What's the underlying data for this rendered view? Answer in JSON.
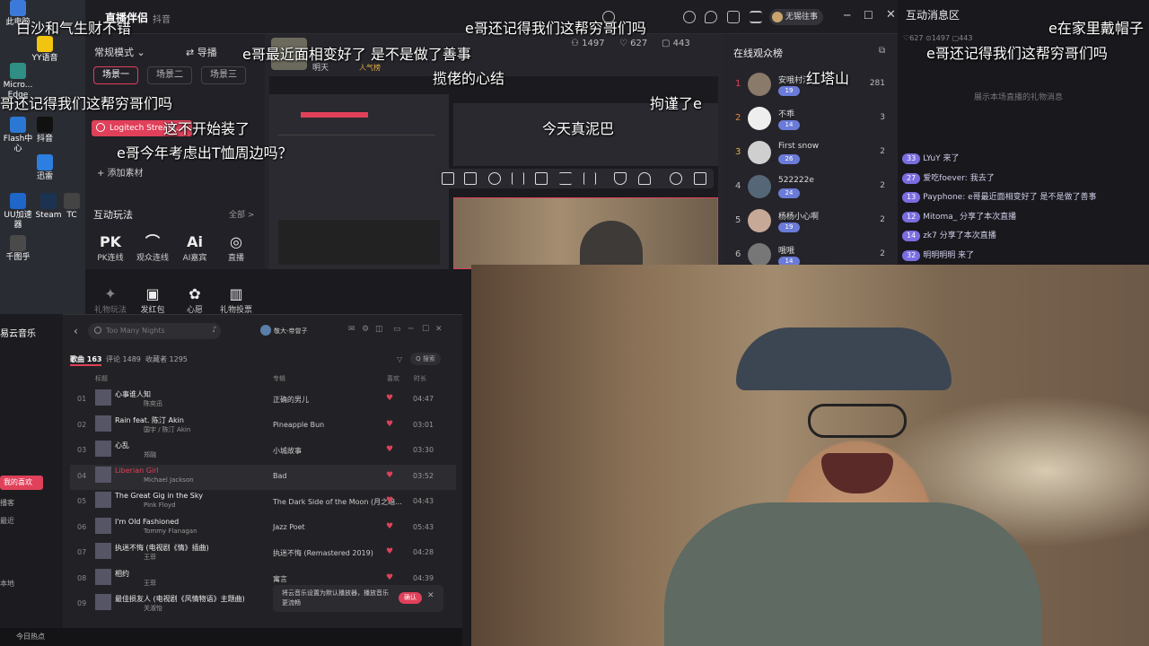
{
  "desktop": {
    "icons": [
      {
        "label": "此电脑",
        "color": "#3b7ad9"
      },
      {
        "label": "Micro...\nEdge",
        "color": "#2f8f84"
      },
      {
        "label": "Flash中\n心",
        "color": "#2a78d4"
      },
      {
        "label": "UU加速\n器",
        "color": "#1f66c9"
      },
      {
        "label": "Steam",
        "color": "#1b3350"
      },
      {
        "label": "千图乎",
        "color": "#4a4a4a"
      },
      {
        "label": "YY语音",
        "color": "#f1c40f"
      },
      {
        "label": "抖音",
        "color": "#111111"
      },
      {
        "label": "迅雷",
        "color": "#2c7ee0"
      },
      {
        "label": "TC",
        "color": "#444444"
      }
    ]
  },
  "console": {
    "title": "直播伴侣",
    "subtitle": "抖音",
    "mode_label": "常规模式",
    "guide_label": "导播",
    "scene_tabs": [
      "场景一",
      "场景二",
      "场景三"
    ],
    "source_item": "Logitech Stream...",
    "add_material": "+ 添加素材",
    "stats": {
      "viewers": "1497",
      "likes": "627",
      "gifts": "443"
    },
    "streamer_name": "明天",
    "streamer_tag": "人气榜",
    "user_label": "无锡往事",
    "interactive_label": "互动玩法",
    "interactive_all": "全部 >",
    "functions": [
      {
        "glyph": "PK",
        "label": "PK连线"
      },
      {
        "glyph": "⌒",
        "label": "观众连线"
      },
      {
        "glyph": "Ai",
        "label": "AI嘉宾"
      },
      {
        "glyph": "◎",
        "label": "直播"
      },
      {
        "glyph": "✦",
        "label": "礼物玩法"
      },
      {
        "glyph": "▣",
        "label": "发红包"
      },
      {
        "glyph": "✿",
        "label": "心愿"
      },
      {
        "glyph": "▥",
        "label": "礼物投票"
      }
    ]
  },
  "audience": {
    "title": "在线观众榜",
    "rows": [
      {
        "rank": "1",
        "name": "安哦村汀",
        "level": "19",
        "score": "281",
        "rank_color": "#e0405a",
        "av_color": "#8a7a6a"
      },
      {
        "rank": "2",
        "name": "不乖",
        "level": "14",
        "score": "3",
        "rank_color": "#e08a40",
        "av_color": "#eeeeee"
      },
      {
        "rank": "3",
        "name": "First snow",
        "level": "26",
        "score": "2",
        "rank_color": "#e0b040",
        "av_color": "#cfcfcf"
      },
      {
        "rank": "4",
        "name": "522222e",
        "level": "24",
        "score": "2",
        "rank_color": "#bbbbbb",
        "av_color": "#556677"
      },
      {
        "rank": "5",
        "name": "杨杨小心啊",
        "level": "19",
        "score": "2",
        "rank_color": "#bbbbbb",
        "av_color": "#c7a998"
      },
      {
        "rank": "6",
        "name": "哦哦",
        "level": "14",
        "score": "2",
        "rank_color": "#bbbbbb",
        "av_color": "#777777"
      }
    ]
  },
  "interact": {
    "title": "互动消息区",
    "stats": "♡627   ⊙1497   ▢443",
    "empty_hint": "展示本场直播的礼物消息",
    "messages": [
      {
        "level": "33",
        "text": "LYuY 来了"
      },
      {
        "level": "27",
        "text": "爱吃foever: 我去了"
      },
      {
        "level": "13",
        "text": "Payphone: e哥最近面相变好了 是不是做了善事"
      },
      {
        "level": "12",
        "text": "Mitoma_ 分享了本次直播"
      },
      {
        "level": "14",
        "text": "zk7 分享了本次直播"
      },
      {
        "level": "32",
        "text": "明明明明 来了"
      }
    ]
  },
  "music": {
    "app_name": "易云音乐",
    "search_placeholder": "Too Many Nights",
    "user_label": "敬大-帝曾子",
    "tabs": [
      "歌曲 163",
      "评论 1489",
      "收藏者 1295"
    ],
    "search_btn": "Q 搜索",
    "col_title": "标题",
    "col_album": "专辑",
    "col_like": "喜欢",
    "col_time": "时长",
    "side_items": [
      "我的喜欢",
      "播客",
      "最近",
      "本地"
    ],
    "tracks": [
      {
        "num": "01",
        "title": "心事谁人知",
        "artist": "陈奕迅",
        "album": "正确的男儿",
        "time": "04:47"
      },
      {
        "num": "02",
        "title": "Rain feat. 陈汀 Akin",
        "artist": "国宇 / 陈汀 Akin",
        "album": "Pineapple Bun",
        "time": "03:01"
      },
      {
        "num": "03",
        "title": "心乱",
        "artist": "郑融",
        "album": "小城故事",
        "time": "03:30"
      },
      {
        "num": "04",
        "title": "Liberian Girl",
        "artist": "Michael Jackson",
        "album": "Bad",
        "time": "03:52"
      },
      {
        "num": "05",
        "title": "The Great Gig in the Sky",
        "artist": "Pink Floyd",
        "album": "The Dark Side of the Moon (月之暗...",
        "time": "04:43"
      },
      {
        "num": "06",
        "title": "I'm Old Fashioned",
        "artist": "Tommy Flanagan",
        "album": "Jazz Poet",
        "time": "05:43"
      },
      {
        "num": "07",
        "title": "执迷不悔 (电视剧《情》插曲)",
        "artist": "王菲",
        "album": "执迷不悔 (Remastered 2019)",
        "time": "04:28"
      },
      {
        "num": "08",
        "title": "相约",
        "artist": "王菲",
        "album": "寓言",
        "time": "04:39"
      },
      {
        "num": "09",
        "title": "最佳损友人 (电视剧《风情物语》主题曲)",
        "artist": "关淑怡",
        "album": "",
        "time": ""
      }
    ],
    "toast": "将云音乐设置为默认播放器，播放音乐更流畅",
    "toast_btn": "确认",
    "taskbar_text": "今日热点"
  },
  "danmaku": [
    "白沙和气生财不错",
    "e哥还记得我们这帮穷哥们吗",
    "e哥最近面相变好了 是不是做了善事",
    "e在家里戴帽子",
    "揽佬的心结",
    "红塔山",
    "e哥还记得我们这帮穷哥们吗",
    "哥还记得我们这帮穷哥们吗",
    "拘谨了e",
    "这不开始装了",
    "今天真泥巴",
    "e哥今年考虑出T恤周边吗？"
  ]
}
